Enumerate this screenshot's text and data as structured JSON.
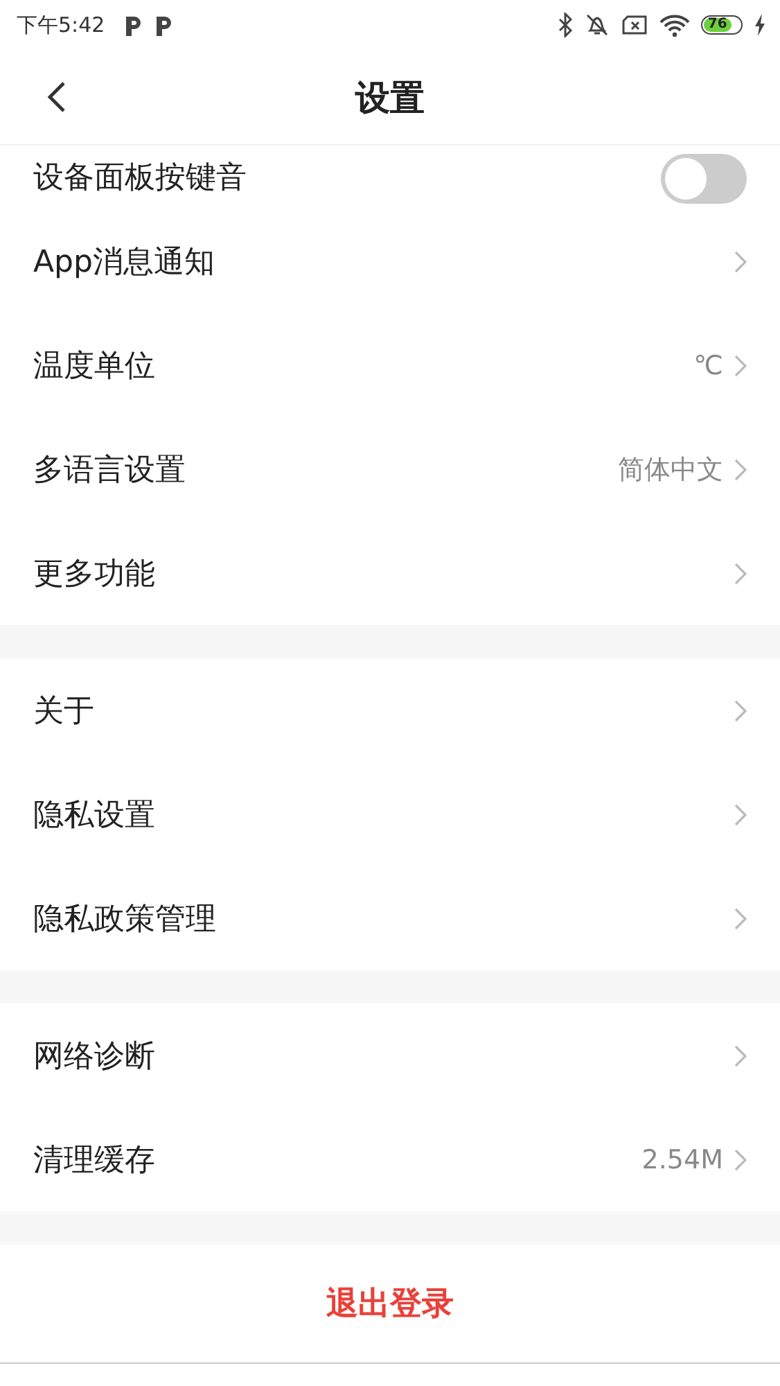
{
  "status_bar": {
    "time": "下午5:42",
    "battery": "76"
  },
  "header": {
    "title": "设置"
  },
  "sections": [
    {
      "items": [
        {
          "kind": "toggle",
          "label": "设备面板按键音",
          "on": false
        },
        {
          "kind": "link",
          "label": "App消息通知"
        },
        {
          "kind": "link",
          "label": "温度单位",
          "value": "℃"
        },
        {
          "kind": "link",
          "label": "多语言设置",
          "value": "简体中文"
        },
        {
          "kind": "link",
          "label": "更多功能"
        }
      ]
    },
    {
      "items": [
        {
          "kind": "link",
          "label": "关于"
        },
        {
          "kind": "link",
          "label": "隐私设置"
        },
        {
          "kind": "link",
          "label": "隐私政策管理"
        }
      ]
    },
    {
      "items": [
        {
          "kind": "link",
          "label": "网络诊断"
        },
        {
          "kind": "link",
          "label": "清理缓存",
          "value": "2.54M"
        }
      ]
    }
  ],
  "logout_button": "退出登录"
}
